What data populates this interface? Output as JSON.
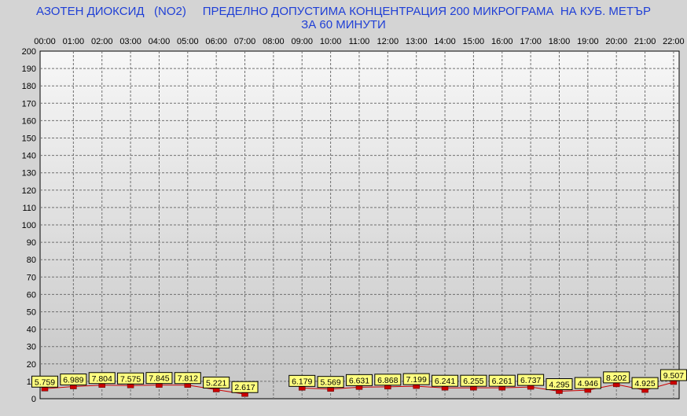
{
  "title_line1": "АЗОТЕН ДИОКСИД   (NO2)     ПРЕДЕЛНО ДОПУСТИМА КОНЦЕНТРАЦИЯ 200 МИКРОГРАМА  НА КУБ. МЕТЪР",
  "title_line2": "ЗА 60 МИНУТИ",
  "colors": {
    "title": "#1f3fd6",
    "background": "#d4d4d4",
    "plot_top": "#f7f7f7",
    "plot_bottom": "#c6c6c6",
    "label_fill": "#ffff80",
    "marker": "#cc0000",
    "line": "#cc0000"
  },
  "chart_data": {
    "type": "line",
    "title": "АЗОТЕН ДИОКСИД (NO2) ПРЕДЕЛНО ДОПУСТИМА КОНЦЕНТРАЦИЯ 200 МИКРОГРАМА НА КУБ. МЕТЪР ЗА 60 МИНУТИ",
    "categories": [
      "00:00",
      "01:00",
      "02:00",
      "03:00",
      "04:00",
      "05:00",
      "06:00",
      "07:00",
      "08:00",
      "09:00",
      "10:00",
      "11:00",
      "12:00",
      "13:00",
      "14:00",
      "15:00",
      "16:00",
      "17:00",
      "18:00",
      "19:00",
      "20:00",
      "21:00",
      "22:00"
    ],
    "values": [
      5.759,
      6.989,
      7.804,
      7.575,
      7.845,
      7.812,
      5.221,
      2.617,
      null,
      6.179,
      5.569,
      6.631,
      6.868,
      7.199,
      6.241,
      6.255,
      6.261,
      6.737,
      4.295,
      4.946,
      8.202,
      4.925,
      9.507
    ],
    "value_labels": [
      "5.759",
      "6.989",
      "7.804",
      "7.575",
      "7.845",
      "7.812",
      "5.221",
      "2.617",
      "",
      "6.179",
      "5.569",
      "6.631",
      "6.868",
      "7.199",
      "6.241",
      "6.255",
      "6.261",
      "6.737",
      "4.295",
      "4.946",
      "8.202",
      "4.925",
      "9.507"
    ],
    "y_ticks": [
      "0",
      "10",
      "20",
      "30",
      "40",
      "50",
      "60",
      "70",
      "80",
      "90",
      "100",
      "110",
      "120",
      "130",
      "140",
      "150",
      "160",
      "170",
      "180",
      "190",
      "200"
    ],
    "ylim": [
      0,
      200
    ],
    "xaxis_position": "top",
    "grid": true,
    "xlabel": "",
    "ylabel": ""
  }
}
